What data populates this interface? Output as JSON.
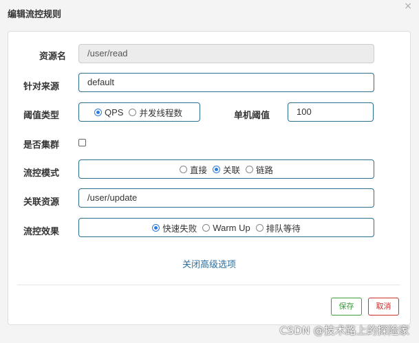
{
  "dialog": {
    "title": "编辑流控规则",
    "close_glyph": "×"
  },
  "form": {
    "resource": {
      "label": "资源名",
      "value": "/user/read"
    },
    "limit_app": {
      "label": "针对来源",
      "value": "default"
    },
    "threshold_type": {
      "label": "阈值类型",
      "options": [
        "QPS",
        "并发线程数"
      ],
      "selected": "QPS"
    },
    "threshold": {
      "label": "单机阈值",
      "value": "100"
    },
    "cluster": {
      "label": "是否集群",
      "checked": false
    },
    "mode": {
      "label": "流控模式",
      "options": [
        "直接",
        "关联",
        "链路"
      ],
      "selected": "关联"
    },
    "ref_resource": {
      "label": "关联资源",
      "value": "/user/update"
    },
    "effect": {
      "label": "流控效果",
      "options": [
        "快速失败",
        "Warm Up",
        "排队等待"
      ],
      "selected": "快速失败"
    },
    "advanced_link": "关闭高级选项"
  },
  "footer": {
    "save_label": "保存",
    "cancel_label": "取消"
  },
  "watermark": "CSDN @技术路上的探险家",
  "colors": {
    "border_accent": "#2b6e8c",
    "radio_selected": "#2a7ae2",
    "save": "#3c9a3c",
    "cancel": "#c9302c",
    "link": "#2b6e9e"
  }
}
